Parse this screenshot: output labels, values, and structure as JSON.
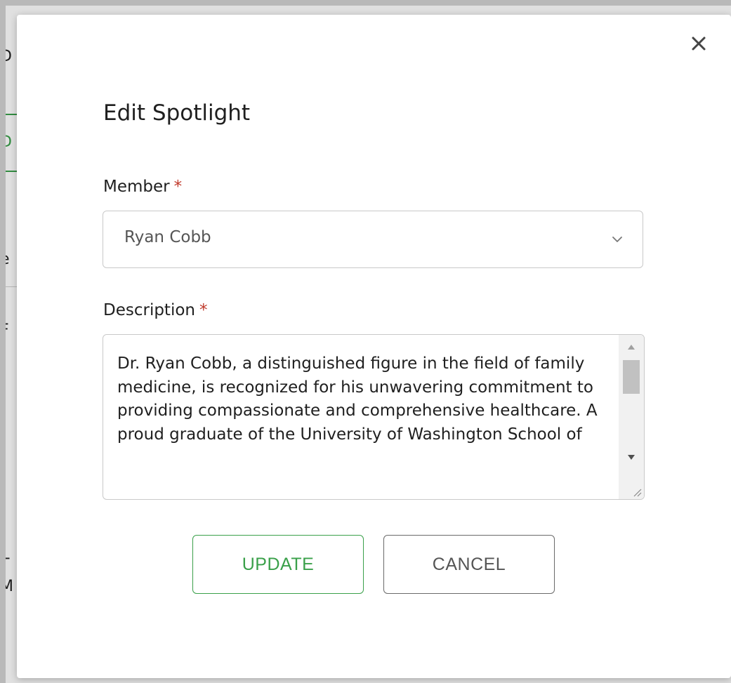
{
  "background": {
    "fragments": [
      "D",
      "D",
      "e",
      "F",
      "T",
      "M"
    ]
  },
  "modal": {
    "close_icon": "close-icon",
    "title": "Edit Spotlight",
    "member": {
      "label": "Member",
      "required_mark": "*",
      "value": "Ryan Cobb",
      "chevron_icon": "chevron-down-icon"
    },
    "description": {
      "label": "Description",
      "required_mark": "*",
      "value": "Dr. Ryan Cobb, a distinguished figure in the field of family medicine, is recognized for his unwavering commitment to providing compassionate and comprehensive healthcare. A proud graduate of the University of Washington School of"
    },
    "buttons": {
      "update": "UPDATE",
      "cancel": "CANCEL"
    }
  },
  "colors": {
    "accent_green": "#3aa04a",
    "required_red": "#c0392b",
    "overlay_gray": "#b9b9b9"
  }
}
